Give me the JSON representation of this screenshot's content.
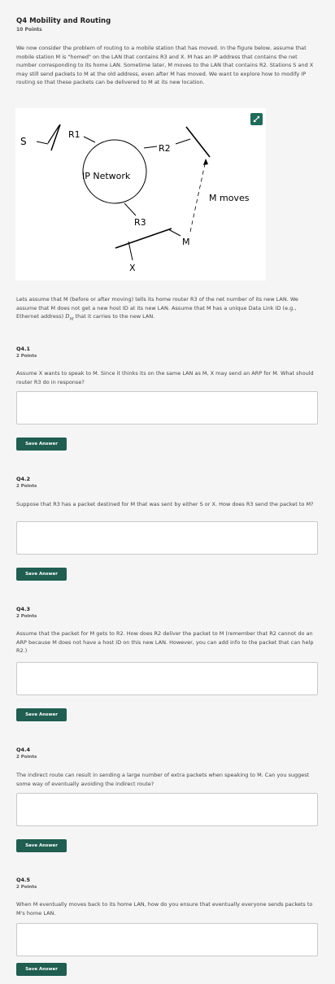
{
  "question": {
    "title": "Q4 Mobility and Routing",
    "points": "10 Points",
    "intro": "We now consider the problem of routing to a mobile station that has moved. In the figure below, assume that mobile station M is \"homed\" on the LAN that contains R3 and X. M has an IP address that contains the net number corresponding to its home LAN. Sometime later, M moves to the LAN that contains R2. Stations S and X may still send packets to M at the old address, even after M has moved. We want to explore how to modify IP routing so that these packets can be delivered to M at its new location.",
    "assume_part1": "Lets assume that M (before or after moving) tells its home router R3 of the net number of its new LAN. We assume that M does not get a new host ID at its new LAN. Assume that M has a unique Data Link ID (e.g., Ethernet address) ",
    "assume_math": "D",
    "assume_math_sub": "M",
    "assume_part2": " that it carries to the new LAN."
  },
  "figure": {
    "labels": {
      "s": "S",
      "r1": "R1",
      "r2": "R2",
      "r3": "R3",
      "ip_network": "IP Network",
      "m_moves": "M moves",
      "m": "M",
      "x": "X"
    },
    "expand_icon": "expand-icon"
  },
  "subquestions": [
    {
      "title": "Q4.1",
      "points": "2 Points",
      "text": "Assume X wants to speak to M. Since it thinks its on the same LAN as M, X may send an ARP for M. What should router R3 do in response?",
      "button": "Save Answer"
    },
    {
      "title": "Q4.2",
      "points": "2 Points",
      "text": "Suppose that R3 has a packet destined for M that was sent by either S or X. How does R3 send the packet to M?",
      "button": "Save Answer"
    },
    {
      "title": "Q4.3",
      "points": "2 Points",
      "text": "Assume that the packet for M gets to R2. How does R2 deliver the packet to M (remember that R2 cannot do an ARP because M does not have a host ID on this new LAN. However, you can add info to the packet that can help R2.)",
      "button": "Save Answer"
    },
    {
      "title": "Q4.4",
      "points": "2 Points",
      "text": "The indirect route can result in sending a large number of extra packets when speaking to M. Can you suggest some way of eventually avoiding the indirect route?",
      "button": "Save Answer"
    },
    {
      "title": "Q4.5",
      "points": "2 Points",
      "text": "When M eventually moves back to its home LAN, how do you ensure that eventually everyone sends packets to M's home LAN.",
      "button": "Save Answer"
    }
  ]
}
